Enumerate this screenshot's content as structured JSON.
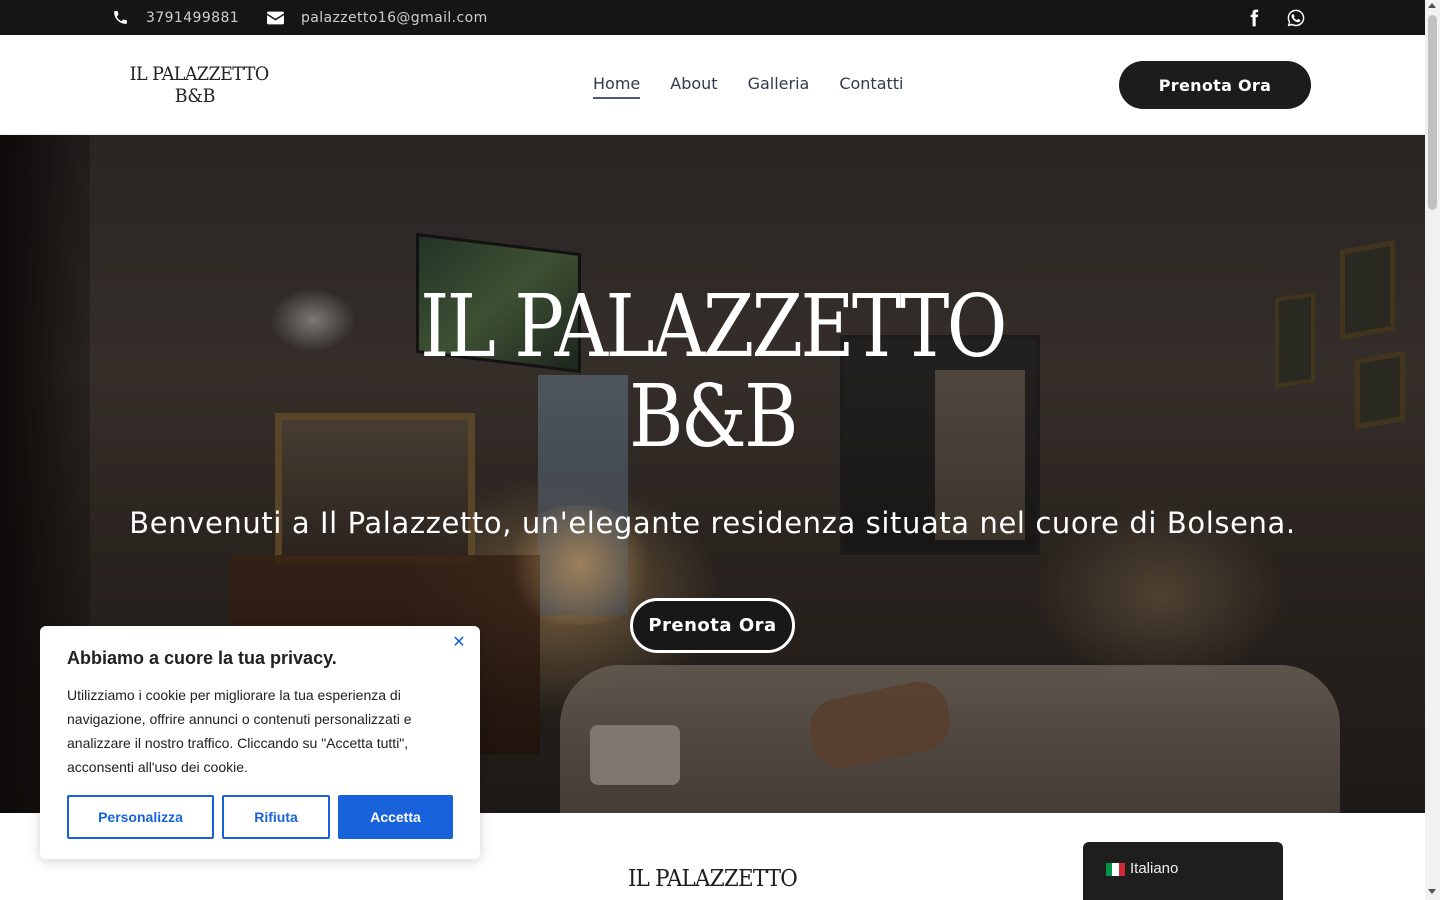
{
  "topbar": {
    "phone": "3791499881",
    "email": "palazzetto16@gmail.com",
    "social": [
      "facebook-icon",
      "whatsapp-icon"
    ]
  },
  "header": {
    "logo_line1": "IL PALAZZETTO",
    "logo_line2": "B&B",
    "nav": [
      {
        "label": "Home",
        "active": true
      },
      {
        "label": "About",
        "active": false
      },
      {
        "label": "Galleria",
        "active": false
      },
      {
        "label": "Contatti",
        "active": false
      }
    ],
    "cta": "Prenota Ora"
  },
  "hero": {
    "title_line1": "IL PALAZZETTO",
    "title_line2": "B&B",
    "subtitle": "Benvenuti a Il Palazzetto, un'elegante residenza situata nel cuore di Bolsena.",
    "cta": "Prenota Ora"
  },
  "section": {
    "logo_line1": "IL PALAZZETTO"
  },
  "cookie": {
    "title": "Abbiamo a cuore la tua privacy.",
    "body": "Utilizziamo i cookie per migliorare la tua esperienza di navigazione, offrire annunci o contenuti personalizzati e analizzare il nostro traffico. Cliccando su \"Accetta tutti\", acconsenti all'uso dei cookie.",
    "customize": "Personalizza",
    "reject": "Rifiuta",
    "accept": "Accetta",
    "accent_color": "#1863dc"
  },
  "language": {
    "label": "Italiano",
    "flag": "italy-flag-icon"
  }
}
